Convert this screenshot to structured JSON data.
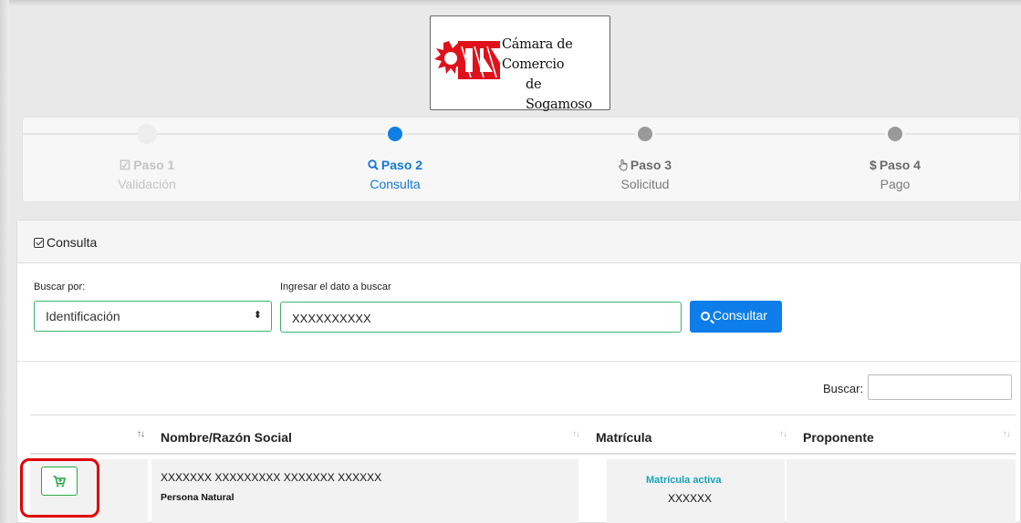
{
  "logo": {
    "line1": "Cámara de Comercio",
    "line2": "de Sogamoso",
    "brand_color": "#e0111a"
  },
  "stepper": {
    "steps": [
      {
        "icon": "check-square-icon",
        "title": "Paso 1",
        "subtitle": "Validación",
        "state": "done"
      },
      {
        "icon": "search-icon",
        "title": "Paso 2",
        "subtitle": "Consulta",
        "state": "active"
      },
      {
        "icon": "hand-pointer-icon",
        "title": "Paso 3",
        "subtitle": "Solicitud",
        "state": "pending"
      },
      {
        "icon": "dollar-icon",
        "title": "Paso 4",
        "subtitle": "Pago",
        "state": "pending"
      }
    ],
    "active_color": "#0d7fe6"
  },
  "card": {
    "header": "Consulta",
    "form": {
      "search_by_label": "Buscar por:",
      "search_by_value": "Identificación",
      "query_label": "Ingresar el dato a buscar",
      "query_value": "XXXXXXXXXX",
      "submit_label": "Consultar"
    },
    "table": {
      "search_label": "Buscar:",
      "columns": [
        "",
        "Nombre/Razón Social",
        "Matrícula",
        "Proponente"
      ],
      "rows": [
        {
          "name": "XXXXXXX  XXXXXXXXX XXXXXXX XXXXXX",
          "type": "Persona Natural",
          "status": "Matrícula activa",
          "matricula": "XXXXXX",
          "proponente": ""
        }
      ]
    }
  },
  "colors": {
    "primary": "#0d7dea",
    "success": "#28a745",
    "info": "#17a2b8",
    "highlight": "#e00000"
  }
}
